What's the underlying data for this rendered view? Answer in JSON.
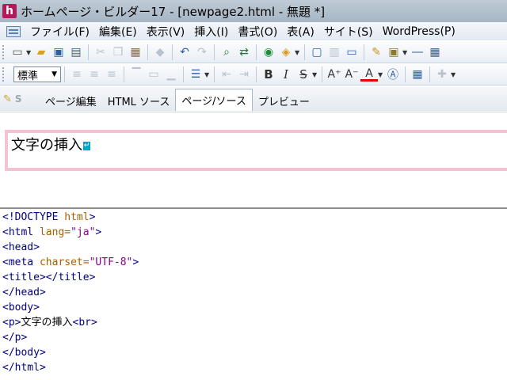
{
  "window": {
    "app_icon_letter": "h",
    "title": "ホームページ・ビルダー17 - [newpage2.html - 無題 *]"
  },
  "menu": [
    "ファイル(F)",
    "編集(E)",
    "表示(V)",
    "挿入(I)",
    "書式(O)",
    "表(A)",
    "サイト(S)",
    "WordPress(P)"
  ],
  "toolbar2": {
    "style_value": "標準",
    "bold": "B",
    "italic": "I",
    "strike": "S"
  },
  "tabs": {
    "s_badge": "S",
    "items": [
      "ページ編集",
      "HTML ソース",
      "ページ/ソース",
      "プレビュー"
    ],
    "active": "ページ/ソース"
  },
  "design": {
    "paragraph_text": "文字の挿入",
    "br_mark": "↵"
  },
  "source": {
    "line1_tag": "<!DOCTYPE",
    "line1_attr": " html",
    "line1_end": ">",
    "line2_open": "<html",
    "line2_attr": " lang=",
    "line2_val": "\"ja\"",
    "line2_end": ">",
    "line3": "<head>",
    "line4_open": "<meta",
    "line4_attr": " charset=",
    "line4_val": "\"UTF-8\"",
    "line4_end": ">",
    "line5": "<title></title>",
    "line6": "</head>",
    "line7": "<body>",
    "line8_open": "<p>",
    "line8_text": "文字の挿入",
    "line8_br": "<br>",
    "line9": "</p>",
    "line10": "</body>",
    "line11": "</html>"
  }
}
